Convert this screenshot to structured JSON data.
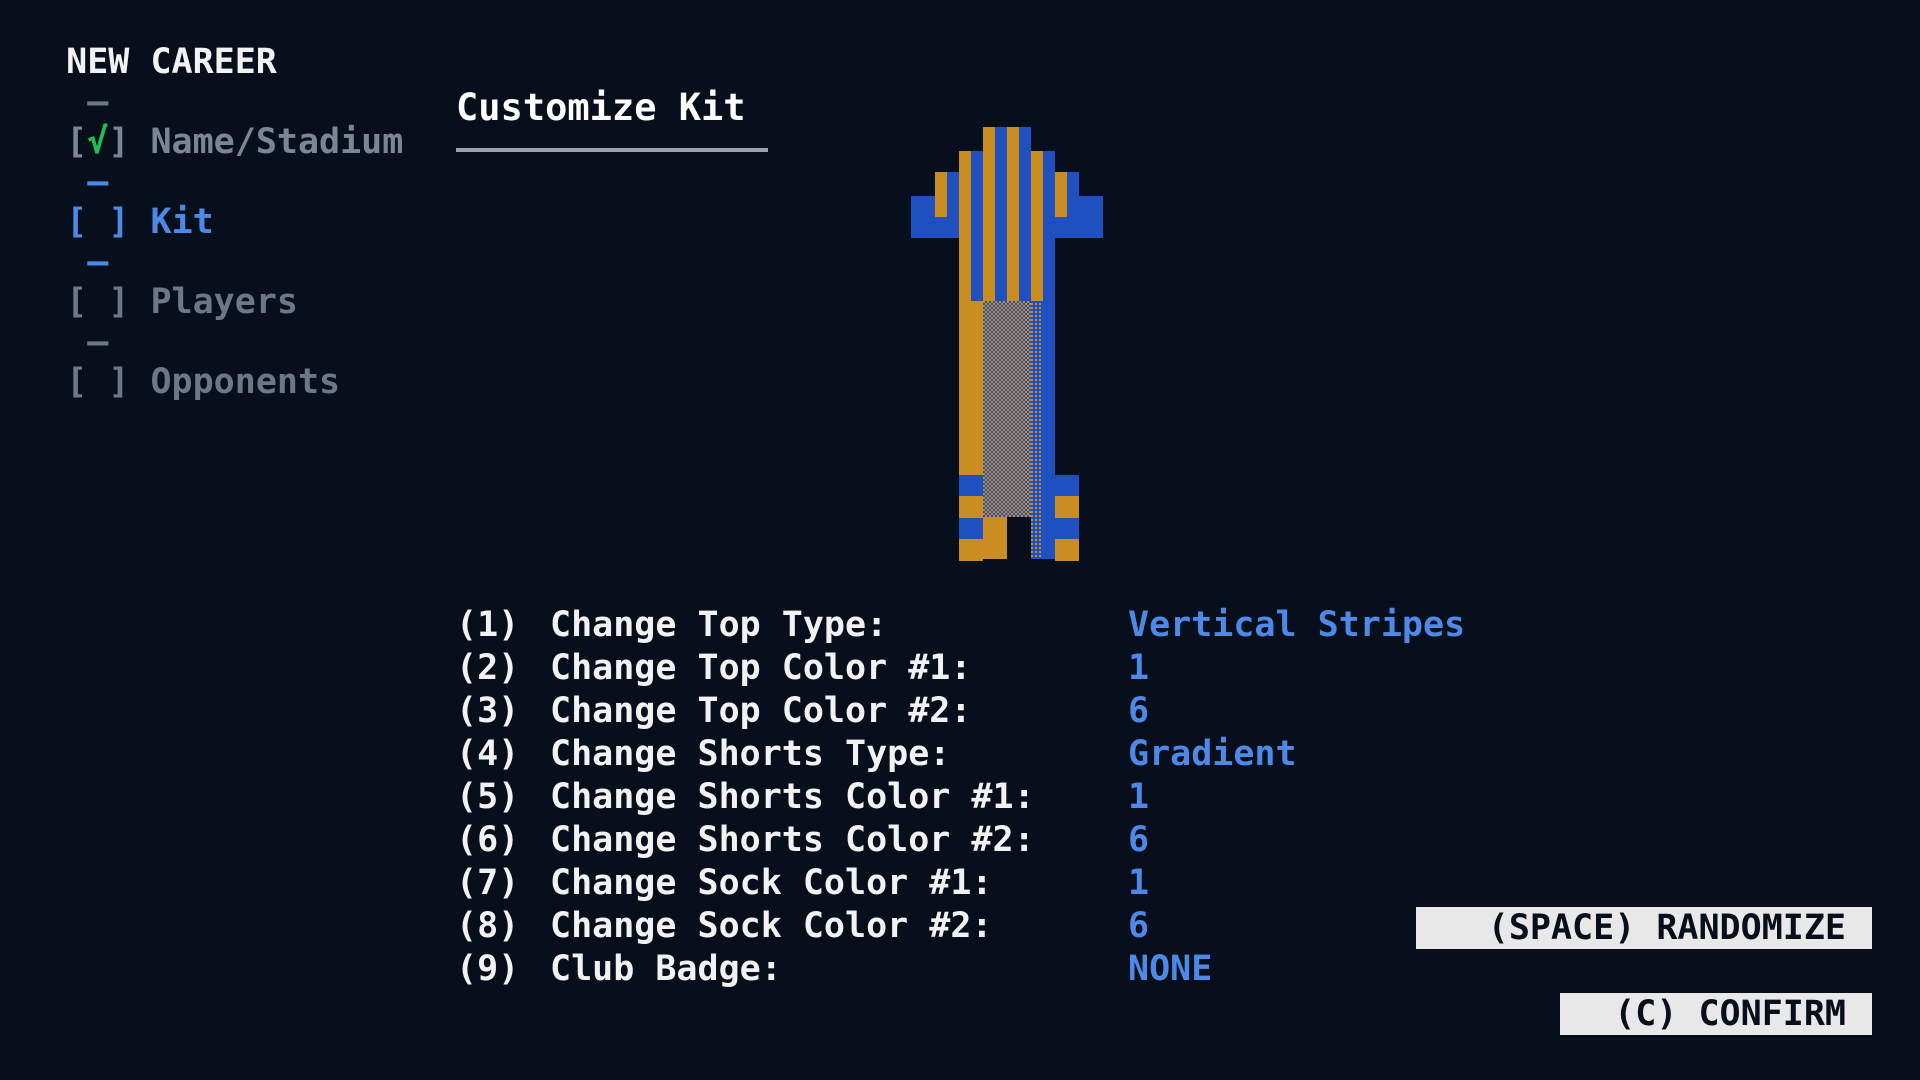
{
  "header": {
    "title": "NEW CAREER",
    "sep": " — ",
    "steps": [
      {
        "open": "[",
        "mark": "√",
        "close": "]",
        "label": "Name/Stadium",
        "state": "done"
      },
      {
        "open": "[",
        "mark": " ",
        "close": "]",
        "label": "Kit",
        "state": "active"
      },
      {
        "open": "[",
        "mark": " ",
        "close": "]",
        "label": "Players",
        "state": "pending"
      },
      {
        "open": "[",
        "mark": " ",
        "close": "]",
        "label": "Opponents",
        "state": "pending"
      }
    ]
  },
  "section": {
    "title": "Customize Kit"
  },
  "kit": {
    "top_type": "Vertical Stripes",
    "shorts_type": "Gradient",
    "colors": {
      "primary": "#c98d22",
      "secondary": "#1f50c0",
      "background": "#080f1c"
    }
  },
  "options": [
    {
      "key": "(1)",
      "label": "Change Top Type:",
      "value": "Vertical Stripes"
    },
    {
      "key": "(2)",
      "label": "Change Top Color #1:",
      "value": "1"
    },
    {
      "key": "(3)",
      "label": "Change Top Color #2:",
      "value": "6"
    },
    {
      "key": "(4)",
      "label": "Change Shorts Type:",
      "value": "Gradient"
    },
    {
      "key": "(5)",
      "label": "Change Shorts Color #1:",
      "value": "1"
    },
    {
      "key": "(6)",
      "label": "Change Shorts Color #2:",
      "value": "6"
    },
    {
      "key": "(7)",
      "label": "Change Sock Color #1:",
      "value": "1"
    },
    {
      "key": "(8)",
      "label": "Change Sock Color #2:",
      "value": "6"
    },
    {
      "key": "(9)",
      "label": "Club Badge:",
      "value": "NONE"
    }
  ],
  "buttons": {
    "randomize": "(SPACE) RANDOMIZE",
    "confirm": "(C) CONFIRM"
  }
}
